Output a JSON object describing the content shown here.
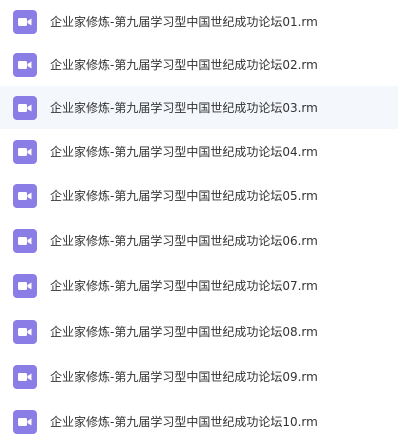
{
  "file_list": {
    "icon": "video-file-icon",
    "icon_color": "#8a7ee6",
    "selected_index": 2,
    "items": [
      {
        "name": "企业家修炼-第九届学习型中国世纪成功论坛01.rm"
      },
      {
        "name": "企业家修炼-第九届学习型中国世纪成功论坛02.rm"
      },
      {
        "name": "企业家修炼-第九届学习型中国世纪成功论坛03.rm"
      },
      {
        "name": "企业家修炼-第九届学习型中国世纪成功论坛04.rm"
      },
      {
        "name": "企业家修炼-第九届学习型中国世纪成功论坛05.rm"
      },
      {
        "name": "企业家修炼-第九届学习型中国世纪成功论坛06.rm"
      },
      {
        "name": "企业家修炼-第九届学习型中国世纪成功论坛07.rm"
      },
      {
        "name": "企业家修炼-第九届学习型中国世纪成功论坛08.rm"
      },
      {
        "name": "企业家修炼-第九届学习型中国世纪成功论坛09.rm"
      },
      {
        "name": "企业家修炼-第九届学习型中国世纪成功论坛10.rm"
      }
    ]
  }
}
